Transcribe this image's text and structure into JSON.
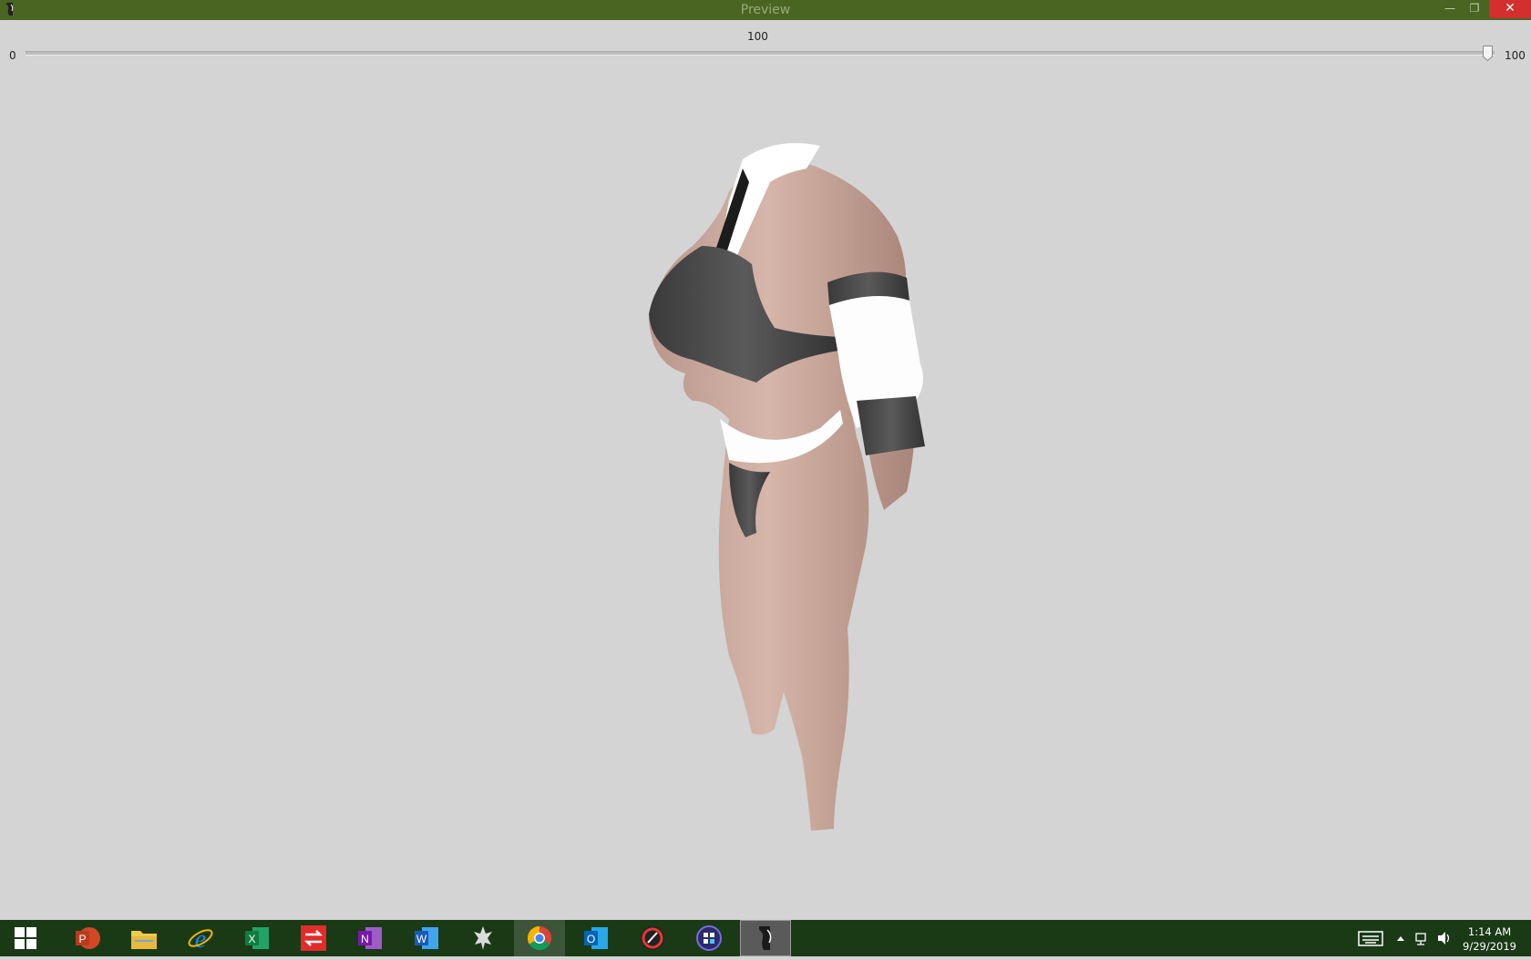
{
  "window": {
    "title": "Preview",
    "controls": [
      "minimize",
      "restore",
      "close"
    ]
  },
  "slider": {
    "value": "100",
    "min_label": "0",
    "max_label": "100",
    "fraction": 1.0
  },
  "viewport": {
    "background": "#d4d4d4",
    "content": "3d-body-preview-model"
  },
  "taskbar": {
    "background": "#1a3a16",
    "apps": [
      {
        "name": "start-icon"
      },
      {
        "name": "powerpoint-icon"
      },
      {
        "name": "file-explorer-icon"
      },
      {
        "name": "internet-explorer-icon"
      },
      {
        "name": "excel-icon"
      },
      {
        "name": "transfer-app-icon"
      },
      {
        "name": "onenote-icon"
      },
      {
        "name": "word-icon"
      },
      {
        "name": "skyrim-icon"
      },
      {
        "name": "chrome-icon"
      },
      {
        "name": "outlook-icon"
      },
      {
        "name": "red-app-icon"
      },
      {
        "name": "blue-app-icon"
      },
      {
        "name": "bodyslide-preview-icon"
      }
    ],
    "time": "1:14 AM",
    "date": "9/29/2019"
  }
}
